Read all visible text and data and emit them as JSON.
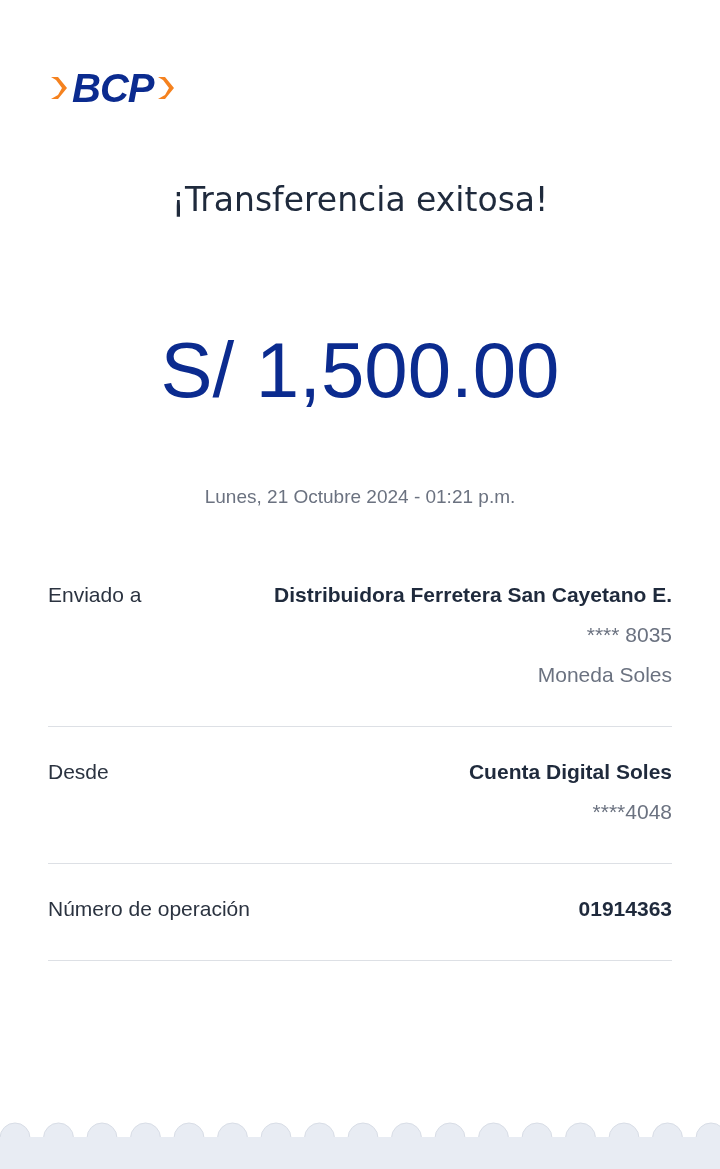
{
  "logo": {
    "text": "BCP"
  },
  "title": "¡Transferencia exitosa!",
  "amount": "S/ 1,500.00",
  "datetime": "Lunes, 21 Octubre 2024 - 01:21 p.m.",
  "details": [
    {
      "label": "Enviado a",
      "value": "Distribuidora Ferretera San Cayetano E.",
      "sublines": [
        "**** 8035",
        "Moneda Soles"
      ]
    },
    {
      "label": "Desde",
      "value": "Cuenta Digital Soles",
      "sublines": [
        "****4048"
      ]
    },
    {
      "label": "Número de operación",
      "value": "01914363"
    }
  ]
}
